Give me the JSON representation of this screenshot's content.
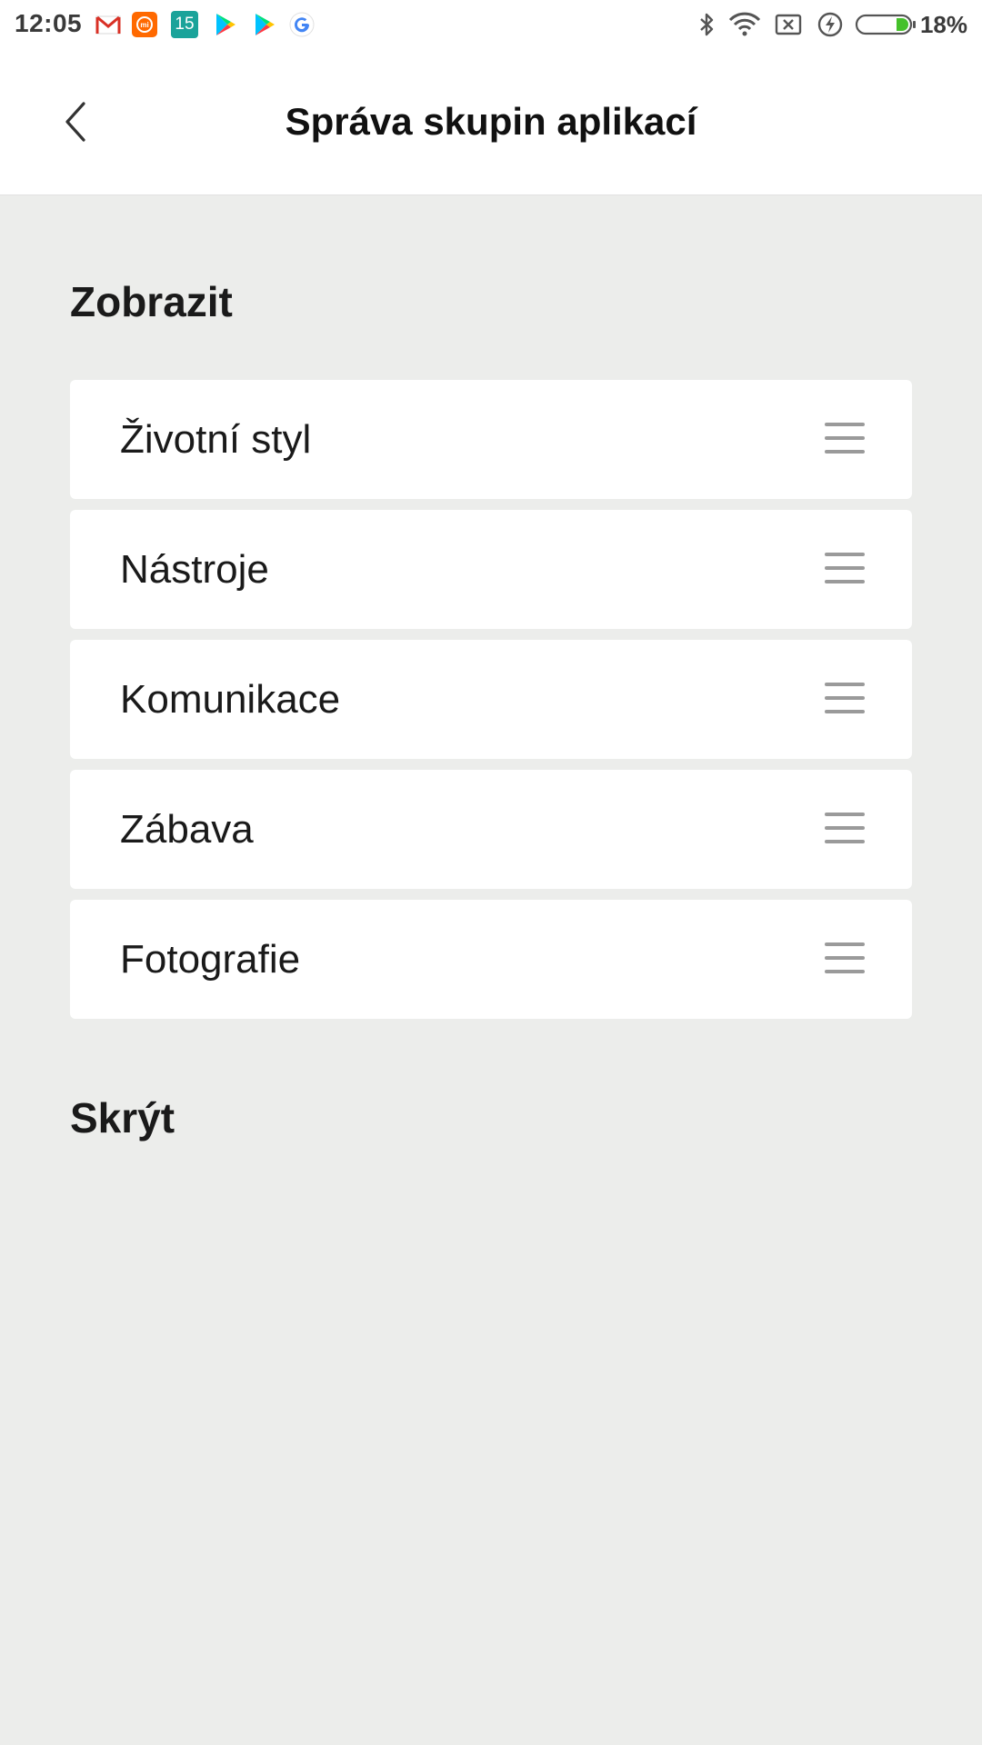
{
  "status_bar": {
    "time": "12:05",
    "notification_icons": [
      "gmail-icon",
      "mi-icon",
      "calendar-icon",
      "play-store-icon",
      "play-store-icon",
      "google-icon"
    ],
    "calendar_day": "15",
    "system_icons": [
      "bluetooth-icon",
      "wifi-icon",
      "no-sim-icon",
      "charging-icon",
      "battery-icon"
    ],
    "battery_percent": "18%",
    "battery_level": 0.18
  },
  "header": {
    "title": "Správa skupin aplikací",
    "back_icon": "chevron-left-icon"
  },
  "sections": {
    "show": {
      "title": "Zobrazit",
      "items": [
        {
          "label": "Životní styl"
        },
        {
          "label": "Nástroje"
        },
        {
          "label": "Komunikace"
        },
        {
          "label": "Zábava"
        },
        {
          "label": "Fotografie"
        }
      ]
    },
    "hide": {
      "title": "Skrýt",
      "items": []
    }
  },
  "colors": {
    "background": "#ecedeb",
    "card": "#ffffff",
    "handle": "#9a9a9a",
    "battery_fill": "#45c12a"
  }
}
